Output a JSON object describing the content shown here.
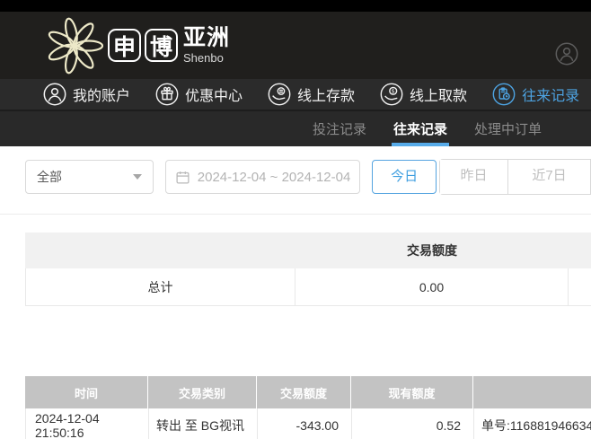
{
  "brand": {
    "boxed_chars": [
      "申",
      "博"
    ],
    "region": "亚洲",
    "subtitle": "Shenbo"
  },
  "header_nav": {
    "items": [
      {
        "label": "我的账户",
        "icon": "user-icon"
      },
      {
        "label": "优惠中心",
        "icon": "gift-icon"
      },
      {
        "label": "线上存款",
        "icon": "deposit-icon"
      },
      {
        "label": "线上取款",
        "icon": "withdraw-icon"
      },
      {
        "label": "往来记录",
        "icon": "records-icon",
        "active": true
      }
    ]
  },
  "tabs": [
    {
      "label": "投注记录",
      "active": false
    },
    {
      "label": "往来记录",
      "active": true
    },
    {
      "label": "处理中订单",
      "active": false
    }
  ],
  "filters": {
    "type_select_value": "全部",
    "date_range_value": "2024-12-04 ~ 2024-12-04",
    "quick_ranges": [
      "今日",
      "昨日",
      "近7日"
    ],
    "active_quick_range": "今日"
  },
  "summary_table": {
    "amount_header": "交易额度",
    "total_label": "总计",
    "total_value": "0.00"
  },
  "records_table": {
    "headers": [
      "时间",
      "交易类别",
      "交易额度",
      "现有额度",
      ""
    ],
    "rows": [
      {
        "time": "2024-12-04 21:50:16",
        "type": "转出 至 BG视讯",
        "amount": "-343.00",
        "balance": "0.52",
        "order": "单号:116881946634"
      }
    ]
  },
  "colors": {
    "accent_blue": "#4da3e2",
    "underline_blue": "#57abe9",
    "logo_cream": "#ede9c8",
    "table_header_gray": "#c3c3c3"
  }
}
